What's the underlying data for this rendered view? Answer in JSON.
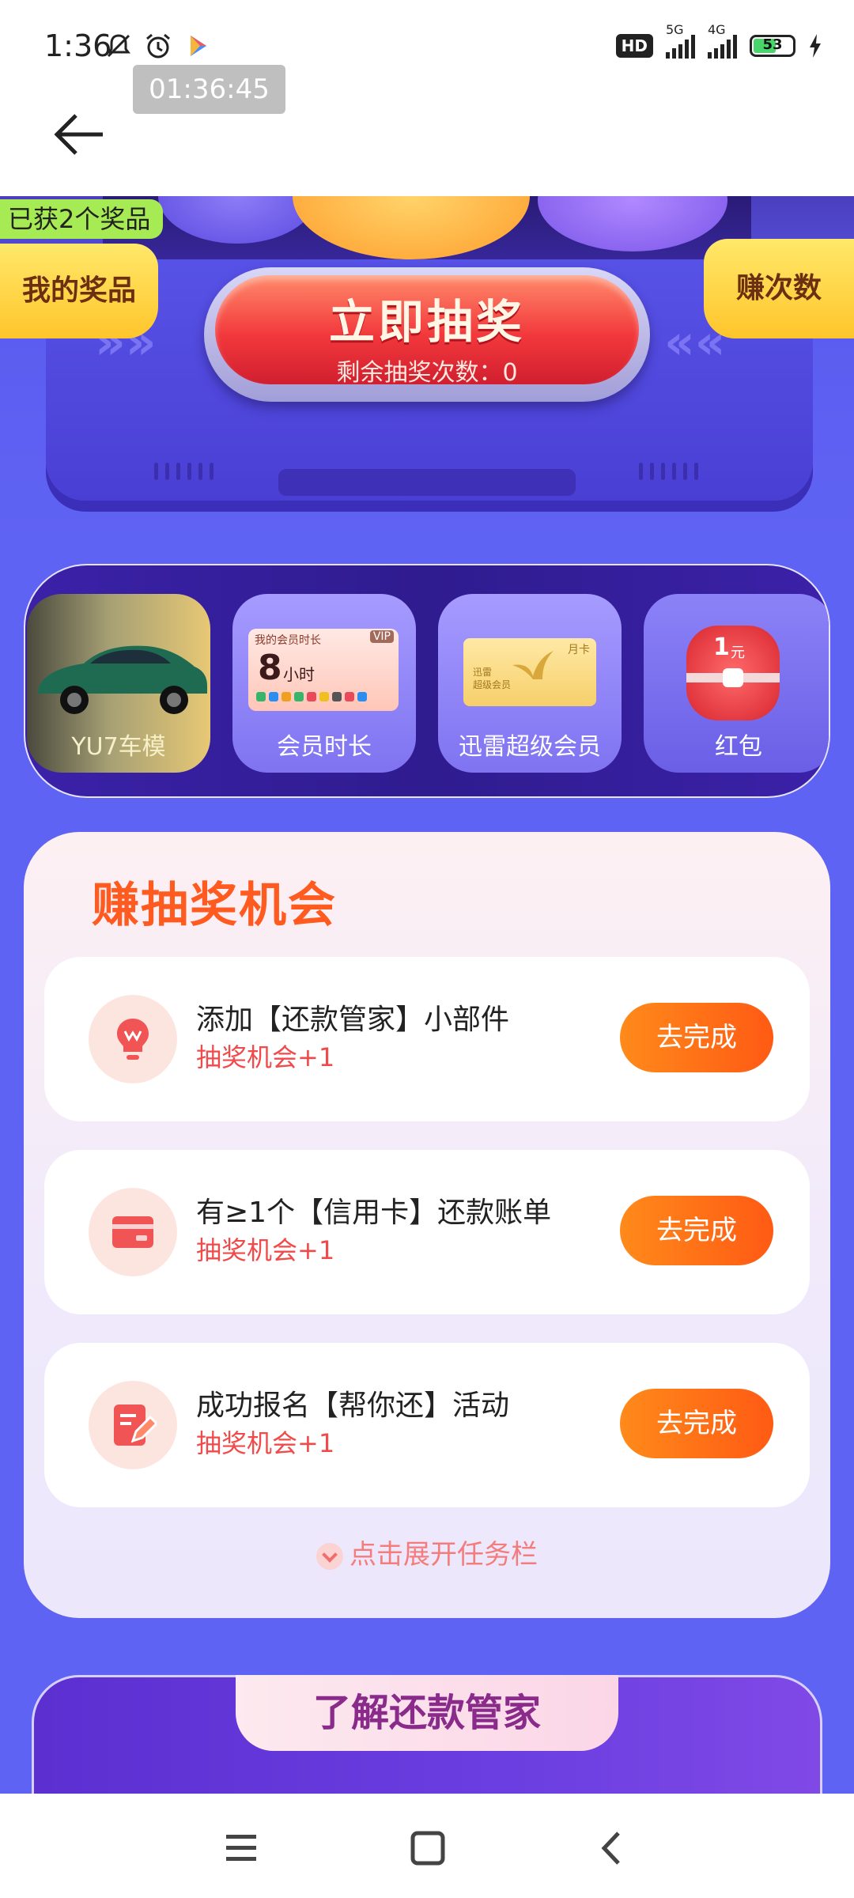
{
  "status_bar": {
    "time": "1:36",
    "hd_label": "HD",
    "signal1_label": "5G",
    "signal2_label": "4G",
    "battery_level": "53"
  },
  "timer_overlay": "01:36:45",
  "hero": {
    "draw_button_title": "立即抽奖",
    "draw_button_sub": "剩余抽奖次数：0",
    "prizes_won_label": "已获2个奖品",
    "my_prizes_label": "我的奖品",
    "earn_times_label": "赚次数"
  },
  "prizes": [
    {
      "name": "YU7车模"
    },
    {
      "name": "会员时长",
      "badge": "VIP",
      "card_title": "我的会员时长",
      "hours": "8",
      "hours_unit": "小时"
    },
    {
      "name": "迅雷超级会员",
      "badge": "月卡",
      "card_line1": "迅雷",
      "card_line2": "超级会员"
    },
    {
      "name": "红包",
      "amount": "1",
      "unit": "元"
    }
  ],
  "tasks_panel": {
    "title": "赚抽奖机会",
    "tasks": [
      {
        "name": "添加【还款管家】小部件",
        "reward": "抽奖机会+1",
        "button": "去完成",
        "icon": "lightbulb-icon"
      },
      {
        "name": "有≥1个【信用卡】还款账单",
        "reward": "抽奖机会+1",
        "button": "去完成",
        "icon": "card-icon"
      },
      {
        "name": "成功报名【帮你还】活动",
        "reward": "抽奖机会+1",
        "button": "去完成",
        "icon": "edit-icon"
      }
    ],
    "expand_label": "点击展开任务栏"
  },
  "learn_section": {
    "title": "了解还款管家"
  },
  "colors": {
    "background": "#5f63f3",
    "accent_orange": "#ff5a14",
    "reward_red": "#f04a4a",
    "draw_red": "#f2383c",
    "gold": "#ffc52b"
  }
}
